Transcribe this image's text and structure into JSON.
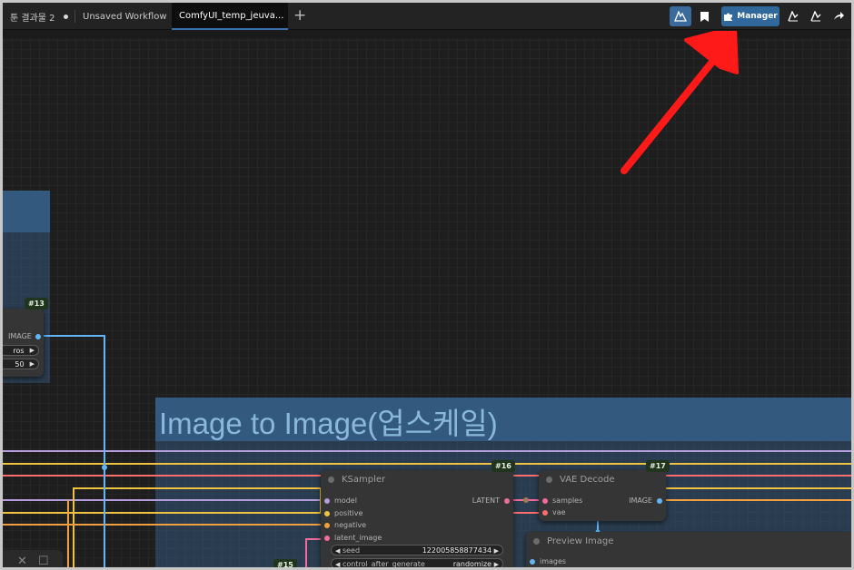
{
  "tabs": [
    {
      "label": "툰 결과물 2",
      "modified": true,
      "active": false
    },
    {
      "label": "Unsaved Workflow",
      "modified": true,
      "active": false
    },
    {
      "label": "ComfyUI_temp_jeuva...",
      "modified": true,
      "active": true
    }
  ],
  "new_tab_glyph": "+",
  "toolbar": {
    "manager_label": "Manager",
    "icons": [
      "comfy-logo-icon",
      "bookmark-icon",
      "puzzle-icon",
      "graph-icon",
      "graph-icon",
      "share-icon"
    ]
  },
  "groups": [
    {
      "title": "Image to Image(업스케일)"
    }
  ],
  "nodes": {
    "upscale": {
      "badge": "#13",
      "output_label": "IMAGE",
      "widgets": [
        {
          "value": "ros"
        },
        {
          "value": "50"
        }
      ]
    },
    "ksampler": {
      "title": "KSampler",
      "badge": "#16",
      "inputs": [
        "model",
        "positive",
        "negative",
        "latent_image"
      ],
      "output_label": "LATENT",
      "widgets": [
        {
          "label": "seed",
          "value": "122005858877434"
        },
        {
          "label": "control_after_generate",
          "value": "randomize"
        }
      ]
    },
    "vae_decode": {
      "title": "VAE Decode",
      "badge": "#17",
      "inputs": [
        "samples",
        "vae"
      ],
      "output_label": "IMAGE"
    },
    "preview": {
      "title": "Preview Image",
      "inputs": [
        "images"
      ]
    },
    "partial": {
      "badge": "#15"
    }
  },
  "colors": {
    "model_wire": "#b39ddb",
    "conditioning_wire": "#f0c241",
    "negative_wire": "#f0a040",
    "latent_wire": "#f36b9e",
    "vae_wire": "#ff6e6e",
    "image_wire": "#64b5f6",
    "accent": "#3c6ea9",
    "annotation_arrow": "#ff1a1a"
  },
  "bottom_tools": [
    "close-icon",
    "square-icon"
  ]
}
